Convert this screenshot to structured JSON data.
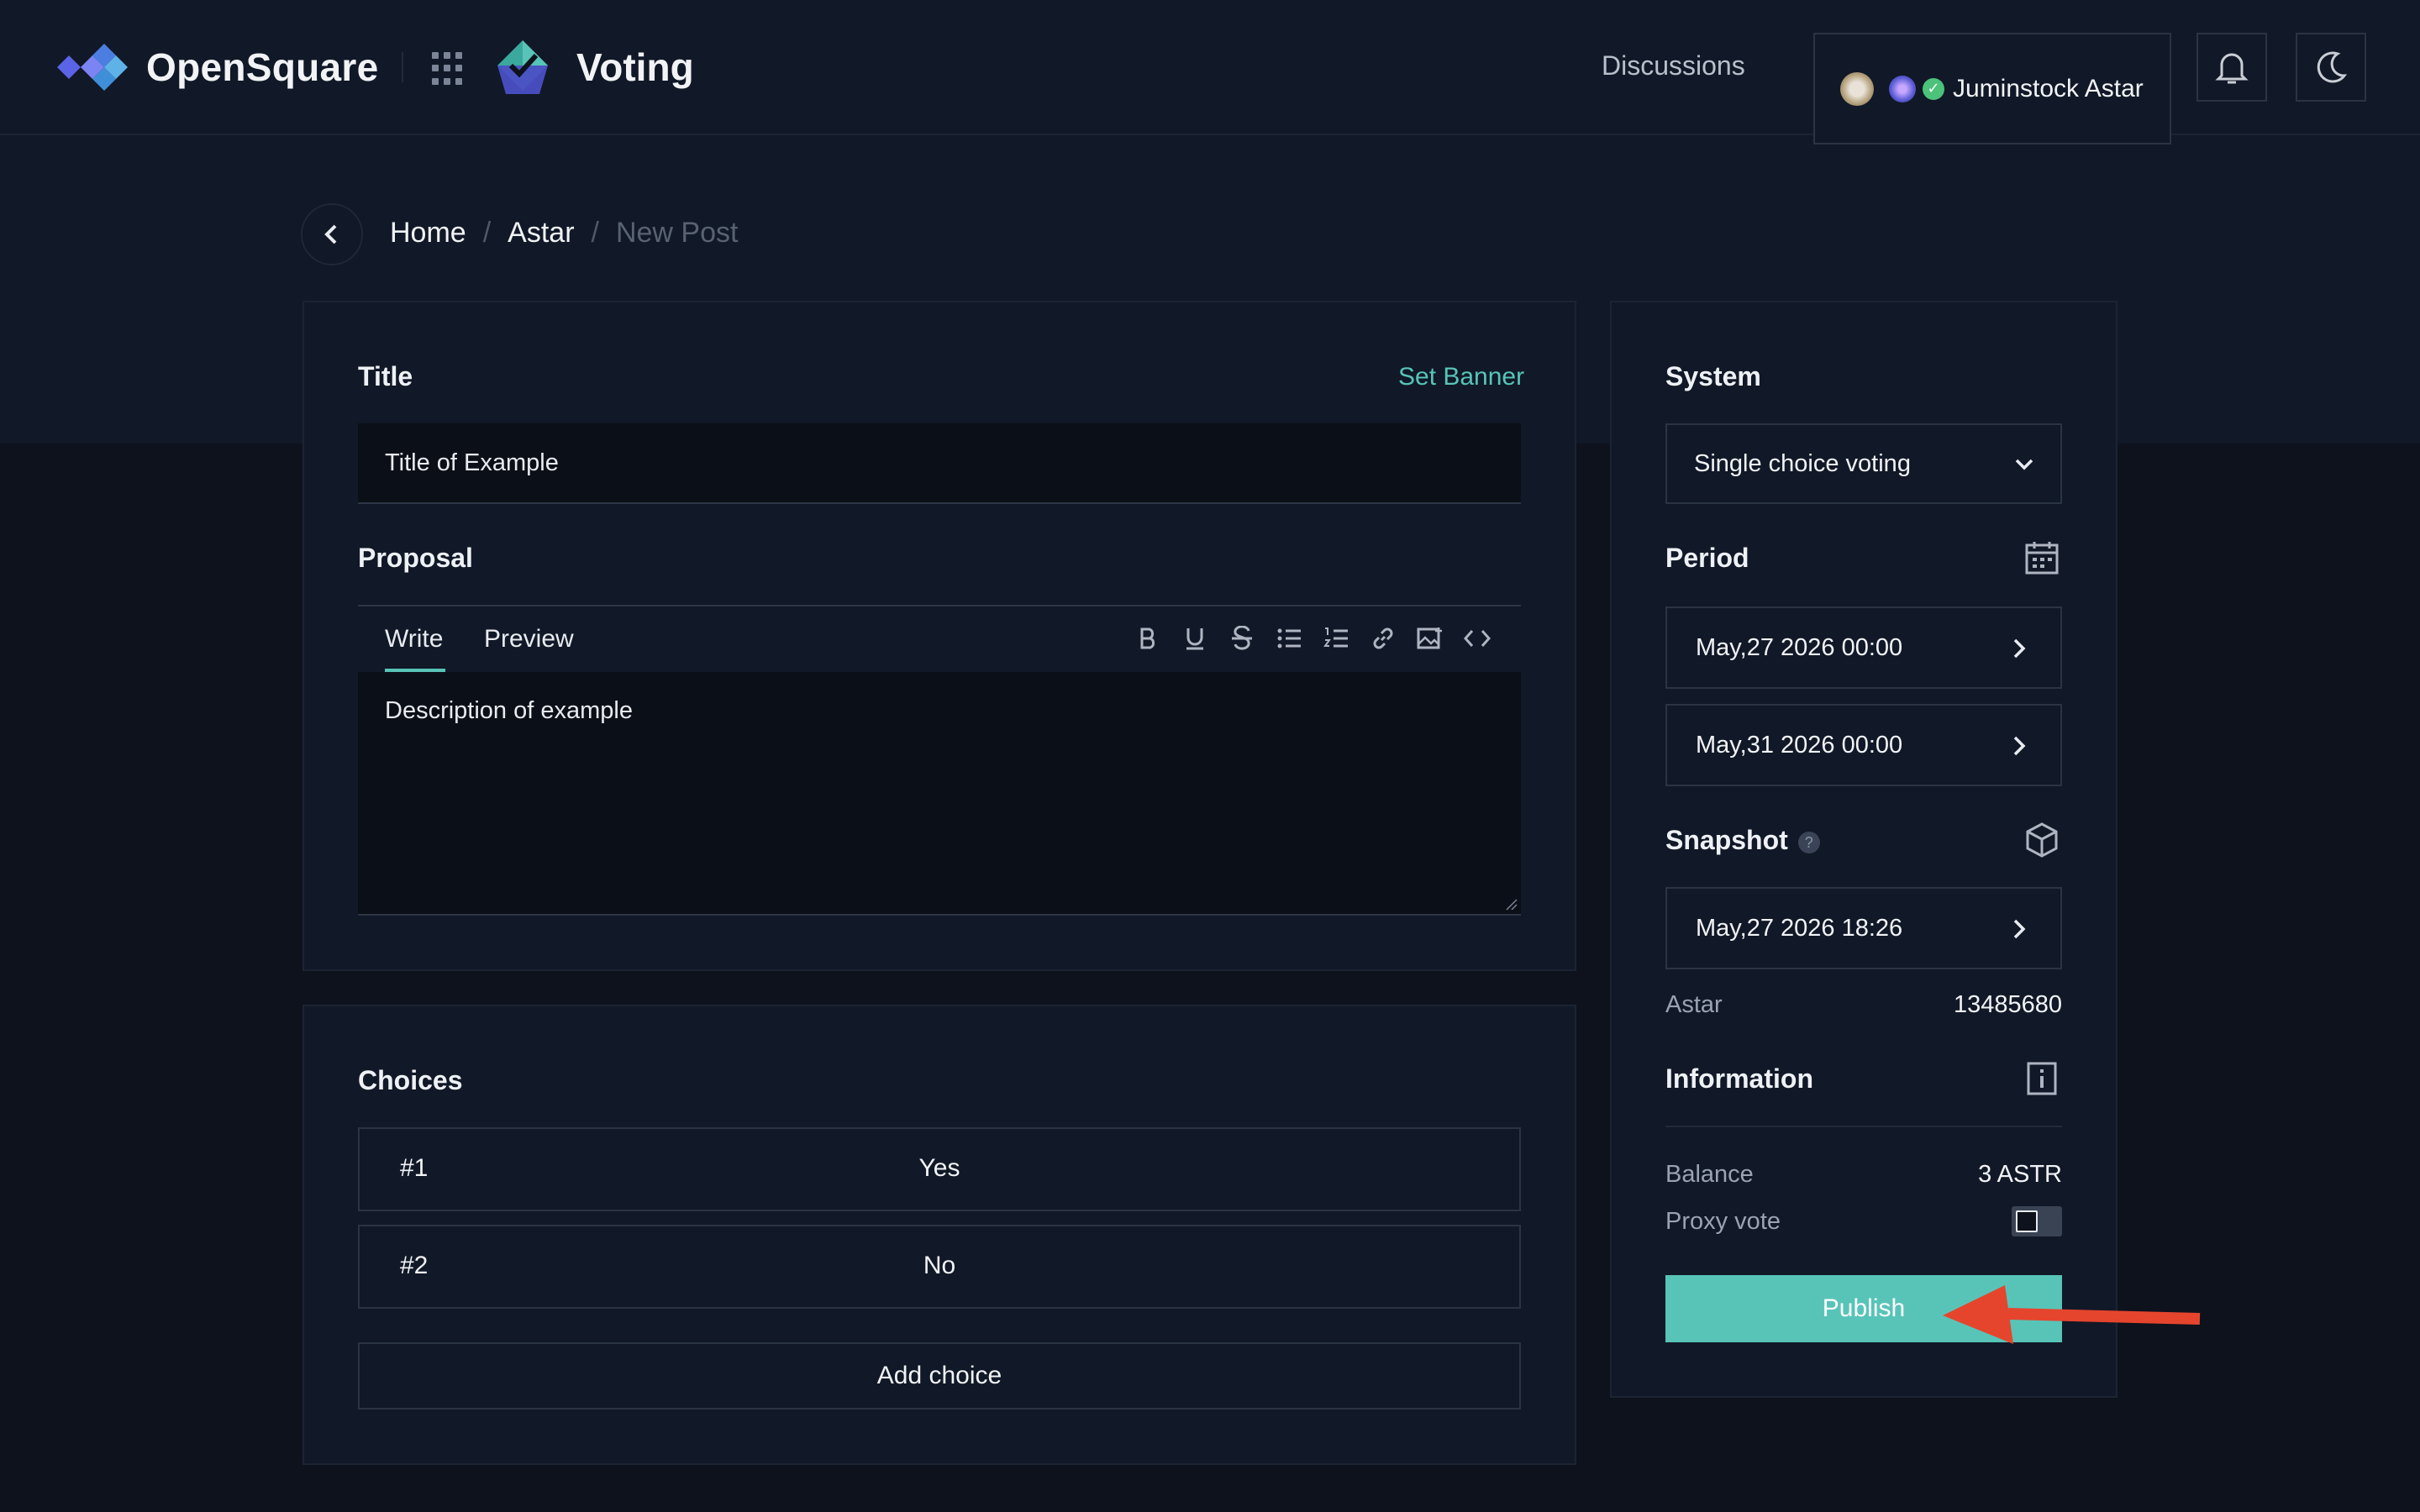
{
  "header": {
    "brand": "OpenSquare",
    "app_name": "Voting",
    "nav_discussions": "Discussions",
    "account_name": "Juminstock Astar"
  },
  "breadcrumb": {
    "home": "Home",
    "space": "Astar",
    "current": "New Post",
    "separator": "/"
  },
  "main": {
    "title_label": "Title",
    "set_banner": "Set Banner",
    "title_value": "Title of Example",
    "proposal_label": "Proposal",
    "tabs": [
      {
        "label": "Write"
      },
      {
        "label": "Preview"
      }
    ],
    "active_tab": "Write",
    "toolbar_icons": [
      "bold-icon",
      "underline-icon",
      "strikethrough-icon",
      "bullet-list-icon",
      "numbered-list-icon",
      "link-icon",
      "image-icon",
      "code-icon"
    ],
    "description_value": "Description of example"
  },
  "choices": {
    "label": "Choices",
    "items": [
      {
        "index": "#1",
        "value": "Yes"
      },
      {
        "index": "#2",
        "value": "No"
      }
    ],
    "add_label": "Add choice"
  },
  "sidebar": {
    "system_label": "System",
    "system_value": "Single choice voting",
    "period_label": "Period",
    "start_date": "May,27 2026 00:00",
    "end_date": "May,31 2026 00:00",
    "snapshot_label": "Snapshot",
    "snapshot_help": "?",
    "snapshot_date": "May,27 2026 18:26",
    "network_name": "Astar",
    "block_height": "13485680",
    "information_label": "Information",
    "balance_label": "Balance",
    "balance_value": "3 ASTR",
    "proxy_label": "Proxy vote",
    "proxy_enabled": false,
    "publish_label": "Publish"
  },
  "colors": {
    "accent": "#58c4b8",
    "background": "#0d121c",
    "panel": "#111827",
    "annotation_arrow": "#e5452d"
  }
}
